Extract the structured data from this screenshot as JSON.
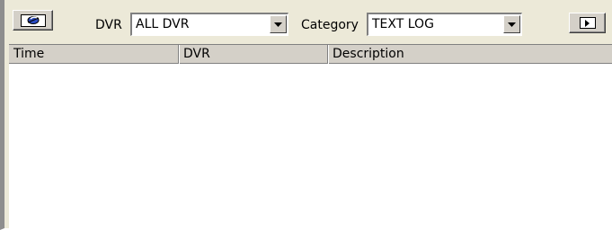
{
  "toolbar": {
    "search_button_icon": "search-icon",
    "play_button_icon": "play-icon",
    "dvr_label": "DVR",
    "dvr_value": "ALL DVR",
    "category_label": "Category",
    "category_value": "TEXT LOG"
  },
  "list": {
    "columns": [
      {
        "label": "Time"
      },
      {
        "label": "DVR"
      },
      {
        "label": "Description"
      }
    ],
    "rows": []
  },
  "colors": {
    "panel_bg": "#ece9d8",
    "control_face": "#d4d0c8",
    "list_bg": "#ffffff",
    "left_border": "#8e8e8e"
  }
}
